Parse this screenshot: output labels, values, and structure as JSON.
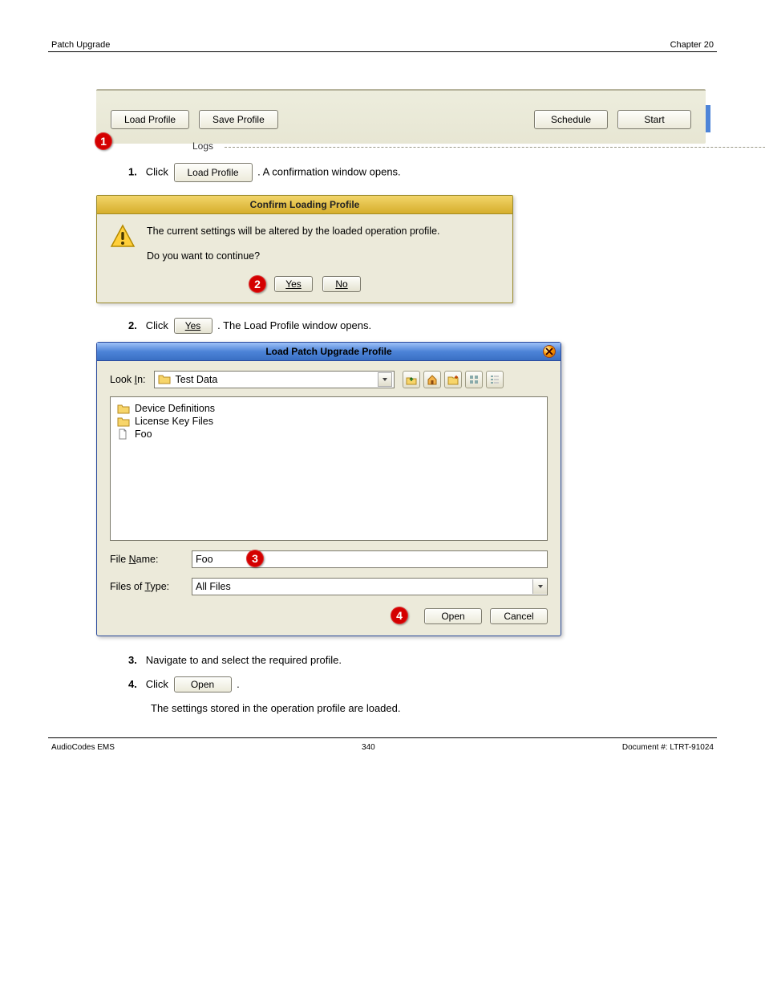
{
  "header": {
    "left": "Patch Upgrade",
    "right": "Chapter 20"
  },
  "toolbar": {
    "load_profile": "Load Profile",
    "save_profile": "Save Profile",
    "schedule": "Schedule",
    "start": "Start",
    "logs_label": "Logs"
  },
  "callouts": {
    "c1": "1",
    "c2": "2",
    "c3": "3",
    "c4": "4"
  },
  "step1_a": "Click",
  "step1_b": ". A confirmation window opens.",
  "confirm": {
    "title": "Confirm Loading Profile",
    "line1": "The current settings will be altered by the loaded operation profile.",
    "line2": "Do you want to continue?",
    "yes": "Yes",
    "no": "No"
  },
  "step2_a": "Click",
  "step2_b": ". The Load Profile window opens.",
  "file_dialog": {
    "title": "Load Patch Upgrade Profile",
    "lookin_label_pre": "Look ",
    "lookin_label_u": "I",
    "lookin_label_post": "n:",
    "lookin_value": "Test Data",
    "items": [
      {
        "name": "Device Definitions",
        "type": "folder"
      },
      {
        "name": "License Key Files",
        "type": "folder"
      },
      {
        "name": "Foo",
        "type": "file"
      }
    ],
    "filename_label_pre": "File ",
    "filename_label_u": "N",
    "filename_label_post": "ame:",
    "filename_value": "Foo",
    "filetype_label_pre": "Files of ",
    "filetype_label_u": "T",
    "filetype_label_post": "ype:",
    "filetype_value": "All Files",
    "open": "Open",
    "cancel": "Cancel"
  },
  "step3": "Navigate to and select the required profile.",
  "step4_a": "Click",
  "step4_b": ".",
  "result": "The settings stored in the operation profile are loaded.",
  "footer": {
    "left": "AudioCodes EMS",
    "center": "340",
    "right": "Document #: LTRT-91024"
  }
}
